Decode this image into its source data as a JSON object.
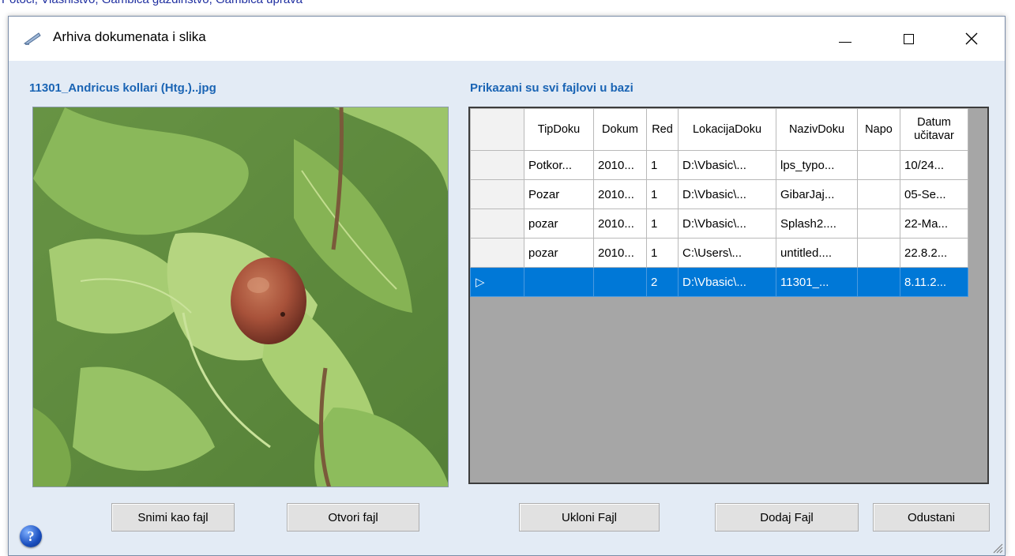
{
  "background_text": "Potoci, Vlasništvo, Gambica gazdinstvo, Gambica uprava",
  "window": {
    "title": "Arhiva dokumenata i slika",
    "minimize_glyph": "",
    "close_glyph": "✕"
  },
  "file_label": "11301_Andricus kollari (Htg.)..jpg",
  "grid_label": "Prikazani su svi fajlovi u bazi",
  "grid": {
    "columns": [
      "TipDoku",
      "Dokum",
      "Red",
      "LokacijaDoku",
      "NazivDoku",
      "Napo",
      "Datum učitavar"
    ],
    "rows": [
      [
        "Potkor...",
        "2010...",
        "1",
        "D:\\Vbasic\\...",
        "lps_typo...",
        "",
        "10/24..."
      ],
      [
        "Pozar",
        "2010...",
        "1",
        "D:\\Vbasic\\...",
        "GibarJaj...",
        "",
        "05-Se..."
      ],
      [
        "pozar",
        "2010...",
        "1",
        "D:\\Vbasic\\...",
        "Splash2....",
        "",
        "22-Ma..."
      ],
      [
        "pozar",
        "2010...",
        "1",
        "C:\\Users\\...",
        "untitled....",
        "",
        "22.8.2..."
      ],
      [
        "",
        "",
        "2",
        "D:\\Vbasic\\...",
        "11301_...",
        "",
        "8.11.2..."
      ]
    ],
    "selected_row_index": 4,
    "selected_row_marker": "▷"
  },
  "buttons": {
    "save_as_file": "Snimi kao fajl",
    "open_file": "Otvori fajl",
    "remove_file": "Ukloni Fajl",
    "add_file": "Dodaj Fajl",
    "cancel": "Odustani"
  },
  "help_glyph": "?",
  "colors": {
    "dialog_background": "#e3ebf5",
    "label_blue": "#1a64b4",
    "selection_blue": "#0078d7",
    "grid_background": "#a6a6a6"
  }
}
